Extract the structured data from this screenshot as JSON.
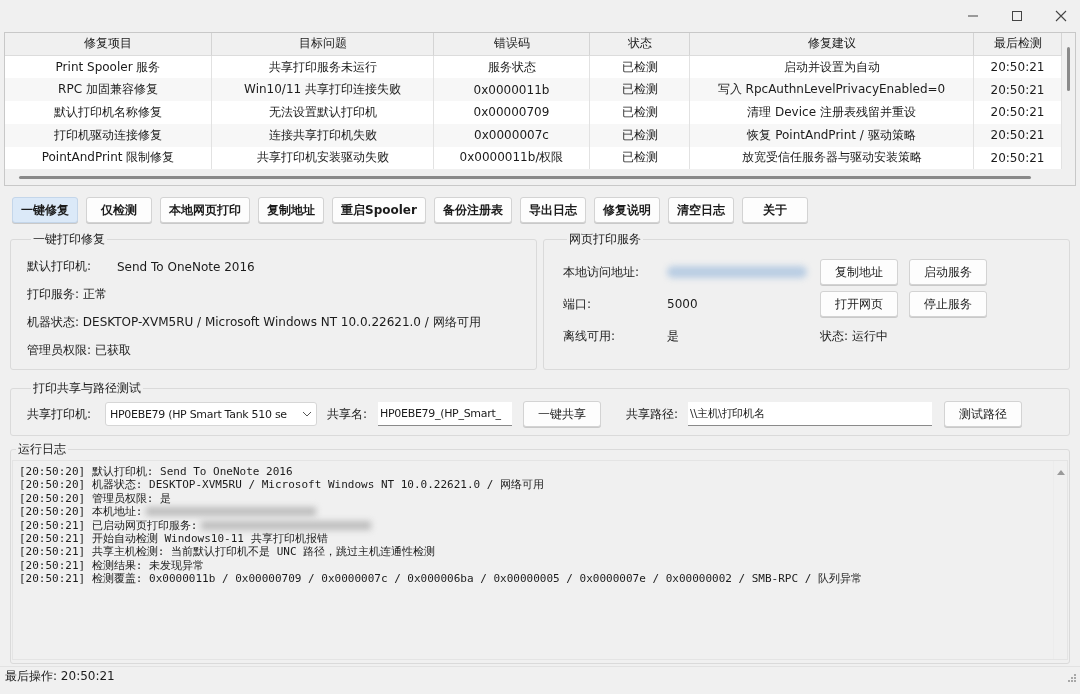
{
  "table": {
    "columns": [
      "修复项目",
      "目标问题",
      "错误码",
      "状态",
      "修复建议",
      "最后检测"
    ],
    "rows": [
      {
        "cells": [
          "Print Spooler 服务",
          "共享打印服务未运行",
          "服务状态",
          "已检测",
          "启动并设置为自动",
          "20:50:21"
        ]
      },
      {
        "cells": [
          "RPC 加固兼容修复",
          "Win10/11 共享打印连接失败",
          "0x0000011b",
          "已检测",
          "写入 RpcAuthnLevelPrivacyEnabled=0",
          "20:50:21"
        ]
      },
      {
        "cells": [
          "默认打印机名称修复",
          "无法设置默认打印机",
          "0x00000709",
          "已检测",
          "清理 Device 注册表残留并重设",
          "20:50:21"
        ]
      },
      {
        "cells": [
          "打印机驱动连接修复",
          "连接共享打印机失败",
          "0x0000007c",
          "已检测",
          "恢复 PointAndPrint / 驱动策略",
          "20:50:21"
        ]
      },
      {
        "cells": [
          "PointAndPrint 限制修复",
          "共享打印机安装驱动失败",
          "0x0000011b/权限",
          "已检测",
          "放宽受信任服务器与驱动安装策略",
          "20:50:21"
        ]
      }
    ]
  },
  "toolbar": {
    "buttons": [
      {
        "label": "一键修复",
        "focused": true
      },
      {
        "label": "仅检测",
        "focused": false
      },
      {
        "label": "本地网页打印",
        "focused": false
      },
      {
        "label": "复制地址",
        "focused": false
      },
      {
        "label": "重启Spooler",
        "focused": false
      },
      {
        "label": "备份注册表",
        "focused": false
      },
      {
        "label": "导出日志",
        "focused": false
      },
      {
        "label": "修复说明",
        "focused": false
      },
      {
        "label": "清空日志",
        "focused": false
      },
      {
        "label": "关于",
        "focused": false
      }
    ]
  },
  "repair_panel": {
    "title": "一键打印修复",
    "items": [
      {
        "kind": "pair",
        "label": "默认打印机:",
        "value": "Send To OneNote 2016"
      },
      {
        "kind": "line",
        "text": "打印服务: 正常"
      },
      {
        "kind": "line",
        "text": "机器状态: DESKTOP-XVM5RU / Microsoft Windows NT 10.0.22621.0 / 网络可用"
      },
      {
        "kind": "line",
        "text": "管理员权限: 已获取"
      }
    ]
  },
  "web_panel": {
    "title": "网页打印服务",
    "rows": [
      {
        "label": "本地访问地址:",
        "kind": "blurred",
        "buttons": [
          "复制地址",
          "启动服务"
        ]
      },
      {
        "label": "端口:",
        "kind": "text",
        "value": "5000",
        "buttons": [
          "打开网页",
          "停止服务"
        ]
      },
      {
        "label": "离线可用:",
        "kind": "text",
        "value": "是",
        "status": "状态: 运行中"
      }
    ]
  },
  "share_panel": {
    "title": "打印共享与路径测试",
    "printer_label": "共享打印机:",
    "printer_value": "HP0EBE79 (HP Smart Tank 510 se",
    "share_name_label": "共享名:",
    "share_name_value": "HP0EBE79_(HP_Smart_",
    "share_button": "一键共享",
    "path_label": "共享路径:",
    "path_value": "\\\\主机\\打印机名",
    "test_button": "测试路径"
  },
  "log": {
    "title": "运行日志",
    "lines": [
      {
        "text": "[20:50:20] 默认打印机: Send To OneNote 2016",
        "blurred": false
      },
      {
        "text": "[20:50:20] 机器状态: DESKTOP-XVM5RU / Microsoft Windows NT 10.0.22621.0 / 网络可用",
        "blurred": false
      },
      {
        "text": "[20:50:20] 管理员权限: 是",
        "blurred": false
      },
      {
        "text": "[20:50:20] 本机地址:",
        "blurred": true
      },
      {
        "text": "[20:50:21] 已启动网页打印服务:",
        "blurred": true
      },
      {
        "text": "[20:50:21] 开始自动检测 Windows10-11 共享打印机报错",
        "blurred": false
      },
      {
        "text": "[20:50:21] 共享主机检测: 当前默认打印机不是 UNC 路径，跳过主机连通性检测",
        "blurred": false
      },
      {
        "text": "[20:50:21] 检测结果: 未发现异常",
        "blurred": false
      },
      {
        "text": "[20:50:21] 检测覆盖: 0x0000011b / 0x00000709 / 0x0000007c / 0x000006ba / 0x00000005 / 0x0000007e / 0x00000002 / SMB-RPC / 队列异常",
        "blurred": false
      }
    ]
  },
  "status_bar": {
    "text": "最后操作: 20:50:21"
  }
}
